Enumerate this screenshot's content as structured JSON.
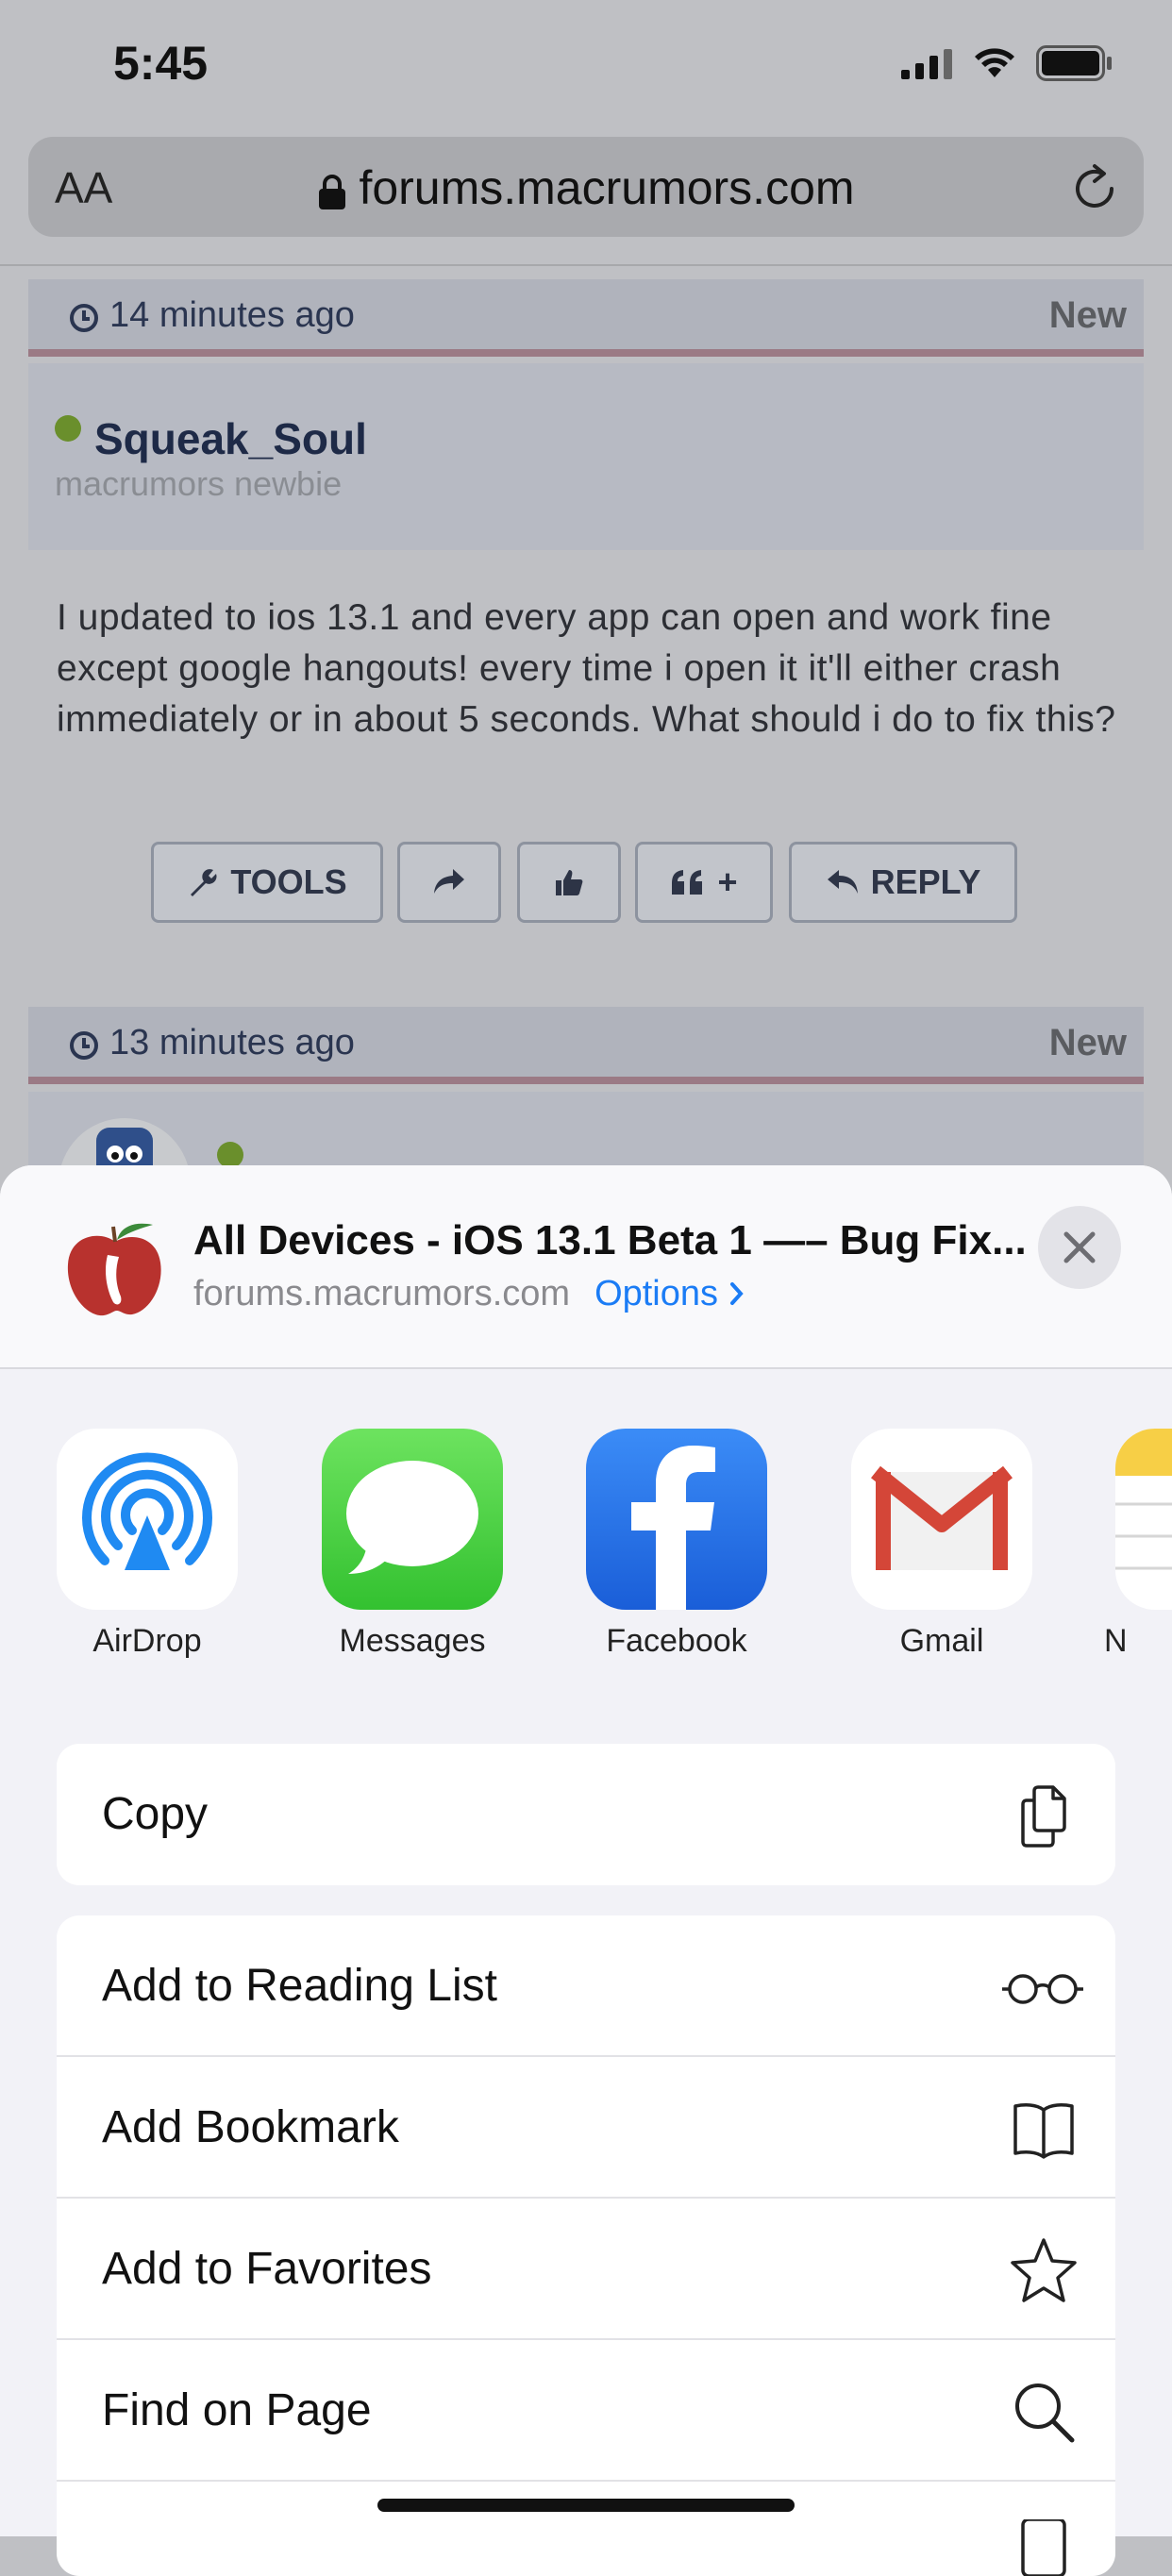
{
  "status_bar": {
    "time": "5:45"
  },
  "browser": {
    "text_size_label": "AA",
    "url": "forums.macrumors.com"
  },
  "post1": {
    "time": "14 minutes ago",
    "new_label": "New",
    "username": "Squeak_Soul",
    "role": "macrumors newbie",
    "body": "I updated to ios 13.1 and every app can open and work fine except google hangouts! every time i open it it'll either crash immediately or in about 5 seconds. What should i do to fix this?",
    "buttons": {
      "tools": "TOOLS",
      "quote": "+",
      "reply": "REPLY"
    }
  },
  "post2": {
    "time": "13 minutes ago",
    "new_label": "New"
  },
  "share_sheet": {
    "title": "All Devices - iOS 13.1 Beta 1 —– Bug Fix...",
    "domain": "forums.macrumors.com",
    "options_label": "Options",
    "apps": [
      {
        "label": "AirDrop",
        "icon": "airdrop-icon"
      },
      {
        "label": "Messages",
        "icon": "messages-icon"
      },
      {
        "label": "Facebook",
        "icon": "facebook-icon"
      },
      {
        "label": "Gmail",
        "icon": "gmail-icon"
      },
      {
        "label": "N",
        "icon": "notes-icon"
      }
    ],
    "actions": [
      {
        "label": "Copy",
        "icon": "copy-icon"
      },
      {
        "label": "Add to Reading List",
        "icon": "glasses-icon"
      },
      {
        "label": "Add Bookmark",
        "icon": "book-icon"
      },
      {
        "label": "Add to Favorites",
        "icon": "star-icon"
      },
      {
        "label": "Find on Page",
        "icon": "search-icon"
      }
    ]
  },
  "colors": {
    "link_blue": "#1b7cf5",
    "online_green": "#6a8f2c",
    "accent_line": "#9b7a85"
  }
}
